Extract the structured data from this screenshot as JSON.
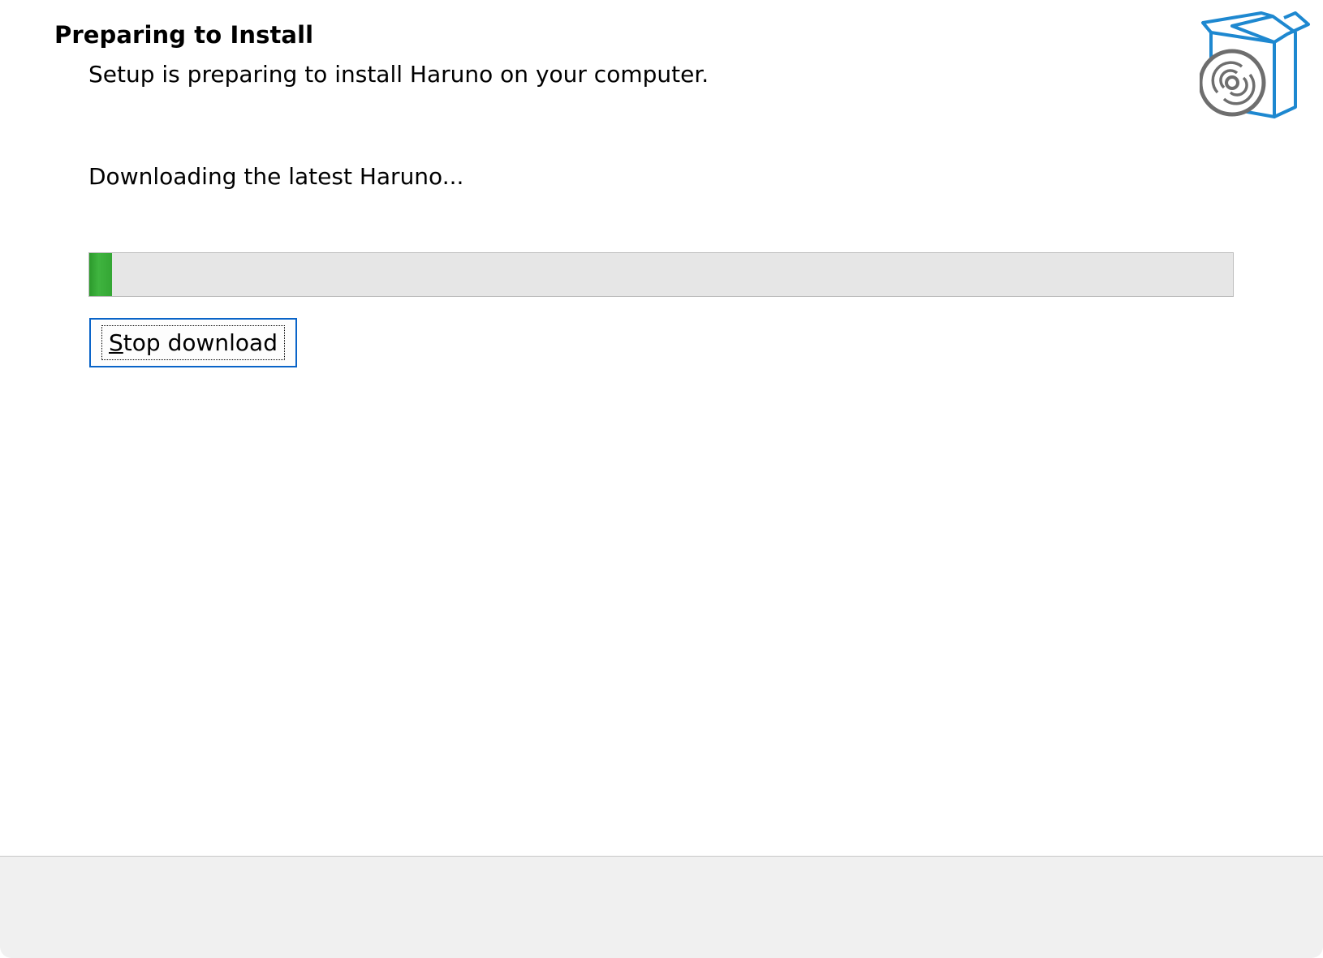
{
  "header": {
    "title": "Preparing to Install",
    "subtitle": "Setup is preparing to install Haruno on your computer.",
    "icon": "installer-box-disc-icon"
  },
  "content": {
    "status": "Downloading the latest Haruno...",
    "progress_fraction": 0.02,
    "stop_button": {
      "accelerator": "S",
      "rest": "top download"
    }
  },
  "colors": {
    "progress_fill": "#34a634",
    "progress_track": "#e6e6e6",
    "icon_blue": "#1e88d0",
    "icon_gray": "#6e6e6e",
    "footer_bg": "#f0f0f0"
  }
}
